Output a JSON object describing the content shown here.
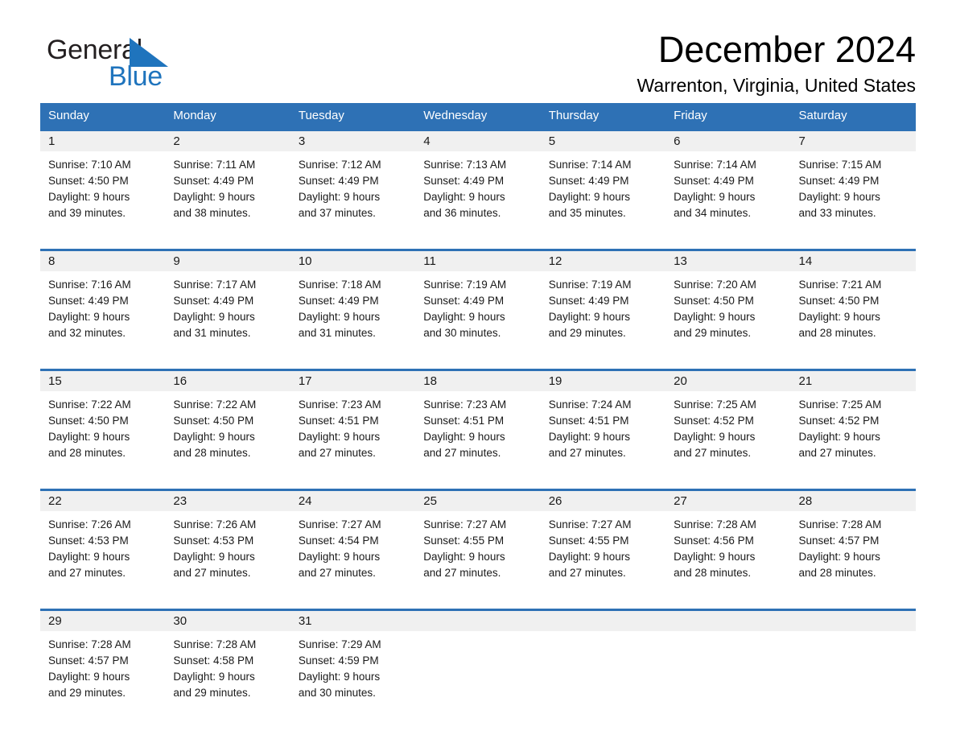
{
  "brand": {
    "name_part1": "General",
    "name_part2": "Blue",
    "triangle_color": "#1f74bd",
    "text_color": "#231f20"
  },
  "header": {
    "month_title": "December 2024",
    "location": "Warrenton, Virginia, United States"
  },
  "theme": {
    "header_blue": "#2e71b5",
    "day_band_gray": "#f0f0f0",
    "text_black": "#1a1a1a",
    "white": "#ffffff"
  },
  "weekdays": [
    "Sunday",
    "Monday",
    "Tuesday",
    "Wednesday",
    "Thursday",
    "Friday",
    "Saturday"
  ],
  "weeks": [
    [
      {
        "day": "1",
        "sunrise": "Sunrise: 7:10 AM",
        "sunset": "Sunset: 4:50 PM",
        "daylight_line1": "Daylight: 9 hours",
        "daylight_line2": "and 39 minutes."
      },
      {
        "day": "2",
        "sunrise": "Sunrise: 7:11 AM",
        "sunset": "Sunset: 4:49 PM",
        "daylight_line1": "Daylight: 9 hours",
        "daylight_line2": "and 38 minutes."
      },
      {
        "day": "3",
        "sunrise": "Sunrise: 7:12 AM",
        "sunset": "Sunset: 4:49 PM",
        "daylight_line1": "Daylight: 9 hours",
        "daylight_line2": "and 37 minutes."
      },
      {
        "day": "4",
        "sunrise": "Sunrise: 7:13 AM",
        "sunset": "Sunset: 4:49 PM",
        "daylight_line1": "Daylight: 9 hours",
        "daylight_line2": "and 36 minutes."
      },
      {
        "day": "5",
        "sunrise": "Sunrise: 7:14 AM",
        "sunset": "Sunset: 4:49 PM",
        "daylight_line1": "Daylight: 9 hours",
        "daylight_line2": "and 35 minutes."
      },
      {
        "day": "6",
        "sunrise": "Sunrise: 7:14 AM",
        "sunset": "Sunset: 4:49 PM",
        "daylight_line1": "Daylight: 9 hours",
        "daylight_line2": "and 34 minutes."
      },
      {
        "day": "7",
        "sunrise": "Sunrise: 7:15 AM",
        "sunset": "Sunset: 4:49 PM",
        "daylight_line1": "Daylight: 9 hours",
        "daylight_line2": "and 33 minutes."
      }
    ],
    [
      {
        "day": "8",
        "sunrise": "Sunrise: 7:16 AM",
        "sunset": "Sunset: 4:49 PM",
        "daylight_line1": "Daylight: 9 hours",
        "daylight_line2": "and 32 minutes."
      },
      {
        "day": "9",
        "sunrise": "Sunrise: 7:17 AM",
        "sunset": "Sunset: 4:49 PM",
        "daylight_line1": "Daylight: 9 hours",
        "daylight_line2": "and 31 minutes."
      },
      {
        "day": "10",
        "sunrise": "Sunrise: 7:18 AM",
        "sunset": "Sunset: 4:49 PM",
        "daylight_line1": "Daylight: 9 hours",
        "daylight_line2": "and 31 minutes."
      },
      {
        "day": "11",
        "sunrise": "Sunrise: 7:19 AM",
        "sunset": "Sunset: 4:49 PM",
        "daylight_line1": "Daylight: 9 hours",
        "daylight_line2": "and 30 minutes."
      },
      {
        "day": "12",
        "sunrise": "Sunrise: 7:19 AM",
        "sunset": "Sunset: 4:49 PM",
        "daylight_line1": "Daylight: 9 hours",
        "daylight_line2": "and 29 minutes."
      },
      {
        "day": "13",
        "sunrise": "Sunrise: 7:20 AM",
        "sunset": "Sunset: 4:50 PM",
        "daylight_line1": "Daylight: 9 hours",
        "daylight_line2": "and 29 minutes."
      },
      {
        "day": "14",
        "sunrise": "Sunrise: 7:21 AM",
        "sunset": "Sunset: 4:50 PM",
        "daylight_line1": "Daylight: 9 hours",
        "daylight_line2": "and 28 minutes."
      }
    ],
    [
      {
        "day": "15",
        "sunrise": "Sunrise: 7:22 AM",
        "sunset": "Sunset: 4:50 PM",
        "daylight_line1": "Daylight: 9 hours",
        "daylight_line2": "and 28 minutes."
      },
      {
        "day": "16",
        "sunrise": "Sunrise: 7:22 AM",
        "sunset": "Sunset: 4:50 PM",
        "daylight_line1": "Daylight: 9 hours",
        "daylight_line2": "and 28 minutes."
      },
      {
        "day": "17",
        "sunrise": "Sunrise: 7:23 AM",
        "sunset": "Sunset: 4:51 PM",
        "daylight_line1": "Daylight: 9 hours",
        "daylight_line2": "and 27 minutes."
      },
      {
        "day": "18",
        "sunrise": "Sunrise: 7:23 AM",
        "sunset": "Sunset: 4:51 PM",
        "daylight_line1": "Daylight: 9 hours",
        "daylight_line2": "and 27 minutes."
      },
      {
        "day": "19",
        "sunrise": "Sunrise: 7:24 AM",
        "sunset": "Sunset: 4:51 PM",
        "daylight_line1": "Daylight: 9 hours",
        "daylight_line2": "and 27 minutes."
      },
      {
        "day": "20",
        "sunrise": "Sunrise: 7:25 AM",
        "sunset": "Sunset: 4:52 PM",
        "daylight_line1": "Daylight: 9 hours",
        "daylight_line2": "and 27 minutes."
      },
      {
        "day": "21",
        "sunrise": "Sunrise: 7:25 AM",
        "sunset": "Sunset: 4:52 PM",
        "daylight_line1": "Daylight: 9 hours",
        "daylight_line2": "and 27 minutes."
      }
    ],
    [
      {
        "day": "22",
        "sunrise": "Sunrise: 7:26 AM",
        "sunset": "Sunset: 4:53 PM",
        "daylight_line1": "Daylight: 9 hours",
        "daylight_line2": "and 27 minutes."
      },
      {
        "day": "23",
        "sunrise": "Sunrise: 7:26 AM",
        "sunset": "Sunset: 4:53 PM",
        "daylight_line1": "Daylight: 9 hours",
        "daylight_line2": "and 27 minutes."
      },
      {
        "day": "24",
        "sunrise": "Sunrise: 7:27 AM",
        "sunset": "Sunset: 4:54 PM",
        "daylight_line1": "Daylight: 9 hours",
        "daylight_line2": "and 27 minutes."
      },
      {
        "day": "25",
        "sunrise": "Sunrise: 7:27 AM",
        "sunset": "Sunset: 4:55 PM",
        "daylight_line1": "Daylight: 9 hours",
        "daylight_line2": "and 27 minutes."
      },
      {
        "day": "26",
        "sunrise": "Sunrise: 7:27 AM",
        "sunset": "Sunset: 4:55 PM",
        "daylight_line1": "Daylight: 9 hours",
        "daylight_line2": "and 27 minutes."
      },
      {
        "day": "27",
        "sunrise": "Sunrise: 7:28 AM",
        "sunset": "Sunset: 4:56 PM",
        "daylight_line1": "Daylight: 9 hours",
        "daylight_line2": "and 28 minutes."
      },
      {
        "day": "28",
        "sunrise": "Sunrise: 7:28 AM",
        "sunset": "Sunset: 4:57 PM",
        "daylight_line1": "Daylight: 9 hours",
        "daylight_line2": "and 28 minutes."
      }
    ],
    [
      {
        "day": "29",
        "sunrise": "Sunrise: 7:28 AM",
        "sunset": "Sunset: 4:57 PM",
        "daylight_line1": "Daylight: 9 hours",
        "daylight_line2": "and 29 minutes."
      },
      {
        "day": "30",
        "sunrise": "Sunrise: 7:28 AM",
        "sunset": "Sunset: 4:58 PM",
        "daylight_line1": "Daylight: 9 hours",
        "daylight_line2": "and 29 minutes."
      },
      {
        "day": "31",
        "sunrise": "Sunrise: 7:29 AM",
        "sunset": "Sunset: 4:59 PM",
        "daylight_line1": "Daylight: 9 hours",
        "daylight_line2": "and 30 minutes."
      },
      {
        "day": "",
        "sunrise": "",
        "sunset": "",
        "daylight_line1": "",
        "daylight_line2": ""
      },
      {
        "day": "",
        "sunrise": "",
        "sunset": "",
        "daylight_line1": "",
        "daylight_line2": ""
      },
      {
        "day": "",
        "sunrise": "",
        "sunset": "",
        "daylight_line1": "",
        "daylight_line2": ""
      },
      {
        "day": "",
        "sunrise": "",
        "sunset": "",
        "daylight_line1": "",
        "daylight_line2": ""
      }
    ]
  ]
}
